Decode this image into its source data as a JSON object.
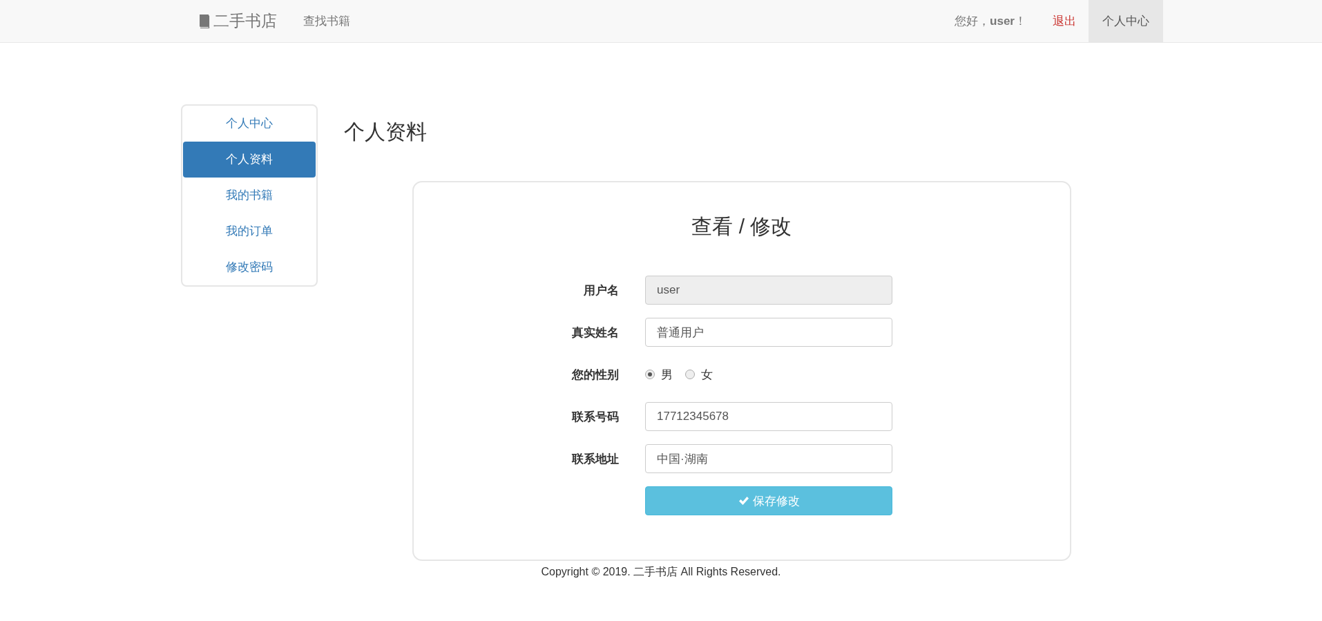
{
  "navbar": {
    "brand": "二手书店",
    "links": [
      {
        "label": "查找书籍"
      }
    ],
    "greeting": "您好，**user**！",
    "logout": "退出",
    "account": {
      "label": "个人中心",
      "selected": true
    }
  },
  "sidebar": {
    "items": [
      {
        "label": "个人中心",
        "selected": false
      },
      {
        "label": "个人资料",
        "selected": true
      },
      {
        "label": "我的书籍",
        "selected": false
      },
      {
        "label": "我的订单",
        "selected": false
      },
      {
        "label": "修改密码",
        "selected": false
      }
    ]
  },
  "page_title": "个人资料",
  "form": {
    "title": "查看 / 修改",
    "fields": [
      {
        "kind": "text",
        "label": "用户名",
        "value": "user",
        "disabled": true
      },
      {
        "kind": "text",
        "label": "真实姓名",
        "value": "普通用户",
        "disabled": false
      },
      {
        "kind": "radio",
        "label": "您的性别",
        "options": [
          {
            "label": "男",
            "selected": true
          },
          {
            "label": "女",
            "selected": false
          }
        ]
      },
      {
        "kind": "text",
        "label": "联系号码",
        "value": "17712345678",
        "disabled": false
      },
      {
        "kind": "text",
        "label": "联系地址",
        "value": "中国·湖南",
        "disabled": false
      }
    ],
    "save_button": "保存修改"
  },
  "footer": "Copyright © 2019. 二手书店 All Rights Reserved."
}
